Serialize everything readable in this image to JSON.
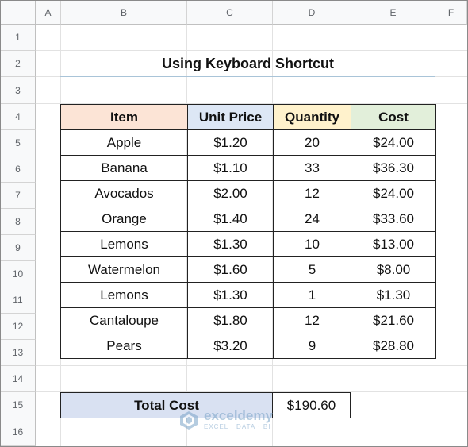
{
  "columns": [
    "A",
    "B",
    "C",
    "D",
    "E",
    "F"
  ],
  "rows": [
    "1",
    "2",
    "3",
    "4",
    "5",
    "6",
    "7",
    "8",
    "9",
    "10",
    "11",
    "12",
    "13",
    "14",
    "15",
    "16"
  ],
  "title": "Using Keyboard Shortcut",
  "table": {
    "headers": {
      "item": "Item",
      "unit_price": "Unit Price",
      "quantity": "Quantity",
      "cost": "Cost"
    },
    "header_colors": {
      "item": "#fce4d6",
      "unit_price": "#dde7f5",
      "quantity": "#fff2cc",
      "cost": "#e2efda"
    },
    "rows": [
      {
        "item": "Apple",
        "unit_price": "$1.20",
        "quantity": "20",
        "cost": "$24.00"
      },
      {
        "item": "Banana",
        "unit_price": "$1.10",
        "quantity": "33",
        "cost": "$36.30"
      },
      {
        "item": "Avocados",
        "unit_price": "$2.00",
        "quantity": "12",
        "cost": "$24.00"
      },
      {
        "item": "Orange",
        "unit_price": "$1.40",
        "quantity": "24",
        "cost": "$33.60"
      },
      {
        "item": "Lemons",
        "unit_price": "$1.30",
        "quantity": "10",
        "cost": "$13.00"
      },
      {
        "item": "Watermelon",
        "unit_price": "$1.60",
        "quantity": "5",
        "cost": "$8.00"
      },
      {
        "item": "Lemons",
        "unit_price": "$1.30",
        "quantity": "1",
        "cost": "$1.30"
      },
      {
        "item": "Cantaloupe",
        "unit_price": "$1.80",
        "quantity": "12",
        "cost": "$21.60"
      },
      {
        "item": "Pears",
        "unit_price": "$3.20",
        "quantity": "9",
        "cost": "$28.80"
      }
    ]
  },
  "total": {
    "label": "Total Cost",
    "value": "$190.60",
    "color": "#d9e1f2"
  },
  "watermark": {
    "name": "exceldemy",
    "tagline": "EXCEL · DATA · BI"
  }
}
